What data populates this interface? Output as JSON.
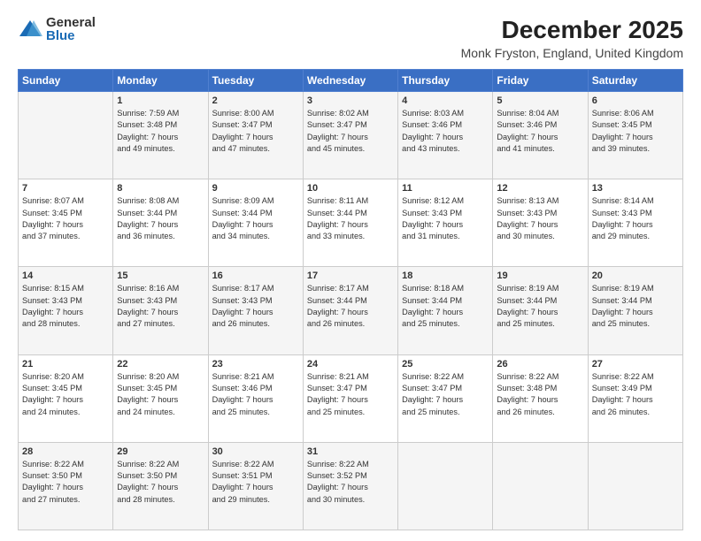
{
  "logo": {
    "general": "General",
    "blue": "Blue"
  },
  "title": "December 2025",
  "location": "Monk Fryston, England, United Kingdom",
  "days_header": [
    "Sunday",
    "Monday",
    "Tuesday",
    "Wednesday",
    "Thursday",
    "Friday",
    "Saturday"
  ],
  "weeks": [
    [
      {
        "day": "",
        "info": ""
      },
      {
        "day": "1",
        "info": "Sunrise: 7:59 AM\nSunset: 3:48 PM\nDaylight: 7 hours\nand 49 minutes."
      },
      {
        "day": "2",
        "info": "Sunrise: 8:00 AM\nSunset: 3:47 PM\nDaylight: 7 hours\nand 47 minutes."
      },
      {
        "day": "3",
        "info": "Sunrise: 8:02 AM\nSunset: 3:47 PM\nDaylight: 7 hours\nand 45 minutes."
      },
      {
        "day": "4",
        "info": "Sunrise: 8:03 AM\nSunset: 3:46 PM\nDaylight: 7 hours\nand 43 minutes."
      },
      {
        "day": "5",
        "info": "Sunrise: 8:04 AM\nSunset: 3:46 PM\nDaylight: 7 hours\nand 41 minutes."
      },
      {
        "day": "6",
        "info": "Sunrise: 8:06 AM\nSunset: 3:45 PM\nDaylight: 7 hours\nand 39 minutes."
      }
    ],
    [
      {
        "day": "7",
        "info": "Sunrise: 8:07 AM\nSunset: 3:45 PM\nDaylight: 7 hours\nand 37 minutes."
      },
      {
        "day": "8",
        "info": "Sunrise: 8:08 AM\nSunset: 3:44 PM\nDaylight: 7 hours\nand 36 minutes."
      },
      {
        "day": "9",
        "info": "Sunrise: 8:09 AM\nSunset: 3:44 PM\nDaylight: 7 hours\nand 34 minutes."
      },
      {
        "day": "10",
        "info": "Sunrise: 8:11 AM\nSunset: 3:44 PM\nDaylight: 7 hours\nand 33 minutes."
      },
      {
        "day": "11",
        "info": "Sunrise: 8:12 AM\nSunset: 3:43 PM\nDaylight: 7 hours\nand 31 minutes."
      },
      {
        "day": "12",
        "info": "Sunrise: 8:13 AM\nSunset: 3:43 PM\nDaylight: 7 hours\nand 30 minutes."
      },
      {
        "day": "13",
        "info": "Sunrise: 8:14 AM\nSunset: 3:43 PM\nDaylight: 7 hours\nand 29 minutes."
      }
    ],
    [
      {
        "day": "14",
        "info": "Sunrise: 8:15 AM\nSunset: 3:43 PM\nDaylight: 7 hours\nand 28 minutes."
      },
      {
        "day": "15",
        "info": "Sunrise: 8:16 AM\nSunset: 3:43 PM\nDaylight: 7 hours\nand 27 minutes."
      },
      {
        "day": "16",
        "info": "Sunrise: 8:17 AM\nSunset: 3:43 PM\nDaylight: 7 hours\nand 26 minutes."
      },
      {
        "day": "17",
        "info": "Sunrise: 8:17 AM\nSunset: 3:44 PM\nDaylight: 7 hours\nand 26 minutes."
      },
      {
        "day": "18",
        "info": "Sunrise: 8:18 AM\nSunset: 3:44 PM\nDaylight: 7 hours\nand 25 minutes."
      },
      {
        "day": "19",
        "info": "Sunrise: 8:19 AM\nSunset: 3:44 PM\nDaylight: 7 hours\nand 25 minutes."
      },
      {
        "day": "20",
        "info": "Sunrise: 8:19 AM\nSunset: 3:44 PM\nDaylight: 7 hours\nand 25 minutes."
      }
    ],
    [
      {
        "day": "21",
        "info": "Sunrise: 8:20 AM\nSunset: 3:45 PM\nDaylight: 7 hours\nand 24 minutes."
      },
      {
        "day": "22",
        "info": "Sunrise: 8:20 AM\nSunset: 3:45 PM\nDaylight: 7 hours\nand 24 minutes."
      },
      {
        "day": "23",
        "info": "Sunrise: 8:21 AM\nSunset: 3:46 PM\nDaylight: 7 hours\nand 25 minutes."
      },
      {
        "day": "24",
        "info": "Sunrise: 8:21 AM\nSunset: 3:47 PM\nDaylight: 7 hours\nand 25 minutes."
      },
      {
        "day": "25",
        "info": "Sunrise: 8:22 AM\nSunset: 3:47 PM\nDaylight: 7 hours\nand 25 minutes."
      },
      {
        "day": "26",
        "info": "Sunrise: 8:22 AM\nSunset: 3:48 PM\nDaylight: 7 hours\nand 26 minutes."
      },
      {
        "day": "27",
        "info": "Sunrise: 8:22 AM\nSunset: 3:49 PM\nDaylight: 7 hours\nand 26 minutes."
      }
    ],
    [
      {
        "day": "28",
        "info": "Sunrise: 8:22 AM\nSunset: 3:50 PM\nDaylight: 7 hours\nand 27 minutes."
      },
      {
        "day": "29",
        "info": "Sunrise: 8:22 AM\nSunset: 3:50 PM\nDaylight: 7 hours\nand 28 minutes."
      },
      {
        "day": "30",
        "info": "Sunrise: 8:22 AM\nSunset: 3:51 PM\nDaylight: 7 hours\nand 29 minutes."
      },
      {
        "day": "31",
        "info": "Sunrise: 8:22 AM\nSunset: 3:52 PM\nDaylight: 7 hours\nand 30 minutes."
      },
      {
        "day": "",
        "info": ""
      },
      {
        "day": "",
        "info": ""
      },
      {
        "day": "",
        "info": ""
      }
    ]
  ]
}
